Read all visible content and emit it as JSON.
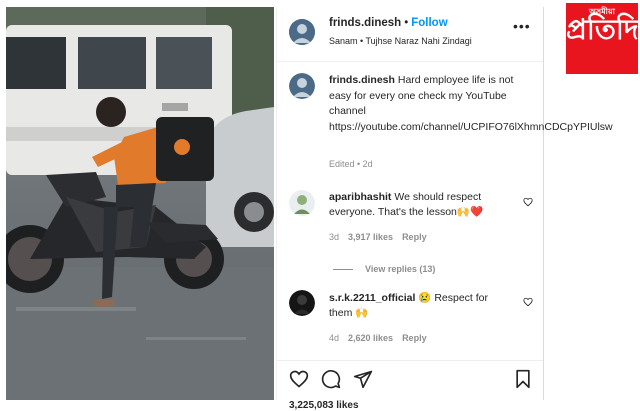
{
  "post": {
    "username": "frinds.dinesh",
    "follow_label": "Follow",
    "header_separator": "•",
    "audio": "Sanam • Tujhse Naraz Nahi Zindagi",
    "more_label": "•••"
  },
  "caption": {
    "username": "frinds.dinesh",
    "text": "Hard employee life is not easy for every one check my YouTube channel https://youtube.com/channel/UCPIFO76lXhmnCDCpYPIUlsw",
    "meta": "Edited • 2d"
  },
  "comments": [
    {
      "username": "aparibhashit",
      "text": "We should respect everyone. That's the lesson🙌❤️",
      "time": "3d",
      "likes": "3,917 likes",
      "reply_label": "Reply"
    },
    {
      "username": "s.r.k.2211_official",
      "text": "😢 Respect for them 🙌",
      "time": "4d",
      "likes": "2,620 likes",
      "reply_label": "Reply"
    }
  ],
  "view_replies": "View replies (13)",
  "likes_total": "3,225,083 likes",
  "logo": {
    "small_text": "অসমীয়া",
    "big_text": "প্রতিদিন",
    "color": "#e8141e"
  },
  "colors": {
    "follow": "#0095f6",
    "muted": "#8e8e8e",
    "heart": "#ed4956"
  }
}
